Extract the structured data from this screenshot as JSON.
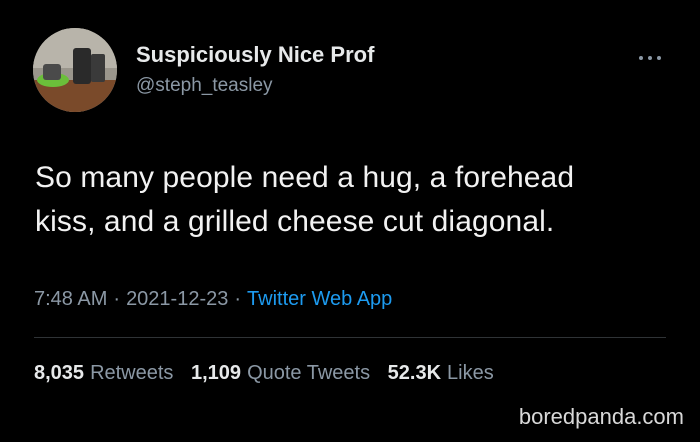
{
  "user": {
    "display_name": "Suspiciously Nice Prof",
    "handle": "@steph_teasley",
    "avatar_icon": "profile-photo-desk"
  },
  "tweet": {
    "text_line1": "So many people need a hug, a forehead",
    "text_line2": "kiss, and a grilled cheese cut diagonal.",
    "time": "7:48 AM",
    "date": "2021-12-23",
    "separator": "·",
    "source": "Twitter Web App"
  },
  "stats": {
    "retweets_count": "8,035",
    "retweets_label": "Retweets",
    "quotes_count": "1,109",
    "quotes_label": "Quote Tweets",
    "likes_count": "52.3K",
    "likes_label": "Likes"
  },
  "watermark": "boredpanda.com",
  "colors": {
    "background": "#000000",
    "text": "#e7e9ea",
    "secondary": "#8b98a5",
    "link": "#1d9bf0"
  }
}
